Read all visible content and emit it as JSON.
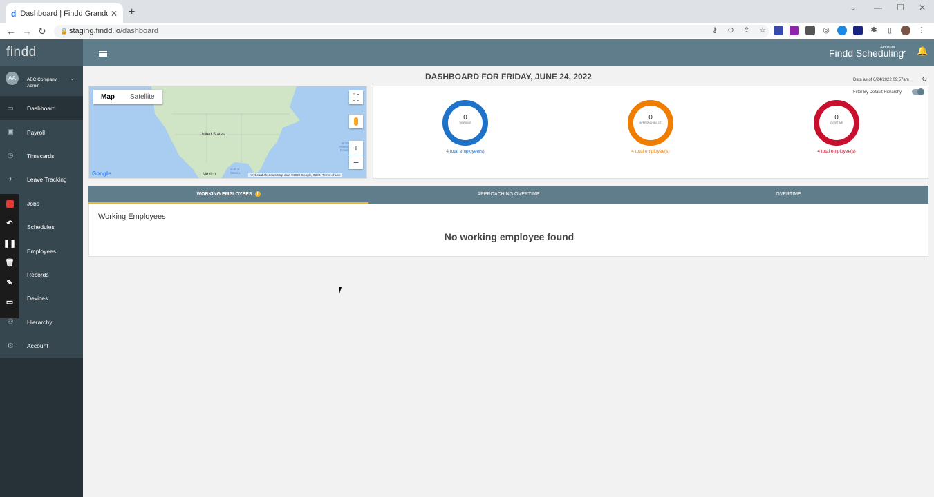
{
  "browser": {
    "tab_title": "Dashboard | Findd Grandd Centr",
    "favicon": "d",
    "url_host": "staging.findd.io",
    "url_path": "/dashboard"
  },
  "sidebar": {
    "logo": "findd",
    "user": {
      "initials": "AA",
      "company": "ABC Company",
      "role": "Admin"
    },
    "items": [
      {
        "label": "Dashboard",
        "icon": "laptop-icon"
      },
      {
        "label": "Payroll",
        "icon": "money-icon"
      },
      {
        "label": "Timecards",
        "icon": "clock-icon"
      },
      {
        "label": "Leave Tracking",
        "icon": "plane-icon"
      },
      {
        "label": "Jobs",
        "icon": "briefcase-icon"
      },
      {
        "label": "Schedules",
        "icon": "calendar-icon"
      },
      {
        "label": "Employees",
        "icon": "people-icon"
      },
      {
        "label": "Records",
        "icon": "file-icon"
      },
      {
        "label": "Devices",
        "icon": "device-icon"
      },
      {
        "label": "Hierarchy",
        "icon": "hierarchy-icon"
      },
      {
        "label": "Account",
        "icon": "gear-icon"
      }
    ]
  },
  "header": {
    "brand": "Findd Scheduling",
    "account_label": "Account"
  },
  "dashboard": {
    "title": "DASHBOARD FOR FRIDAY, JUNE 24, 2022",
    "data_as_of": "Data as of 6/24/2022 09:57am",
    "filter_label": "Filter By Default Hierarchy"
  },
  "map": {
    "tab_map": "Map",
    "tab_satellite": "Satellite",
    "label_us": "United States",
    "label_mexico": "Mexico",
    "label_gulf": "Gulf of Mexico",
    "label_ocean": "North Atlantic Ocean",
    "footer": "Keyboard shortcuts   Map data ©2022 Google, INEGI   Terms of Use",
    "logo": "Google"
  },
  "stats": [
    {
      "value": "0",
      "caption": "WORKING",
      "total": "4 total employee(s)",
      "color": "#1e73c8"
    },
    {
      "value": "0",
      "caption": "APPROACHING OT",
      "total": "4 total employee(s)",
      "color": "#ef7d00"
    },
    {
      "value": "0",
      "caption": "OVERTIME",
      "total": "4 total employee(s)",
      "color": "#c8102e"
    }
  ],
  "tabs": [
    "WORKING EMPLOYEES",
    "APPROACHING OVERTIME",
    "OVERTIME"
  ],
  "panel": {
    "title": "Working Employees",
    "empty_message": "No working employee found"
  }
}
